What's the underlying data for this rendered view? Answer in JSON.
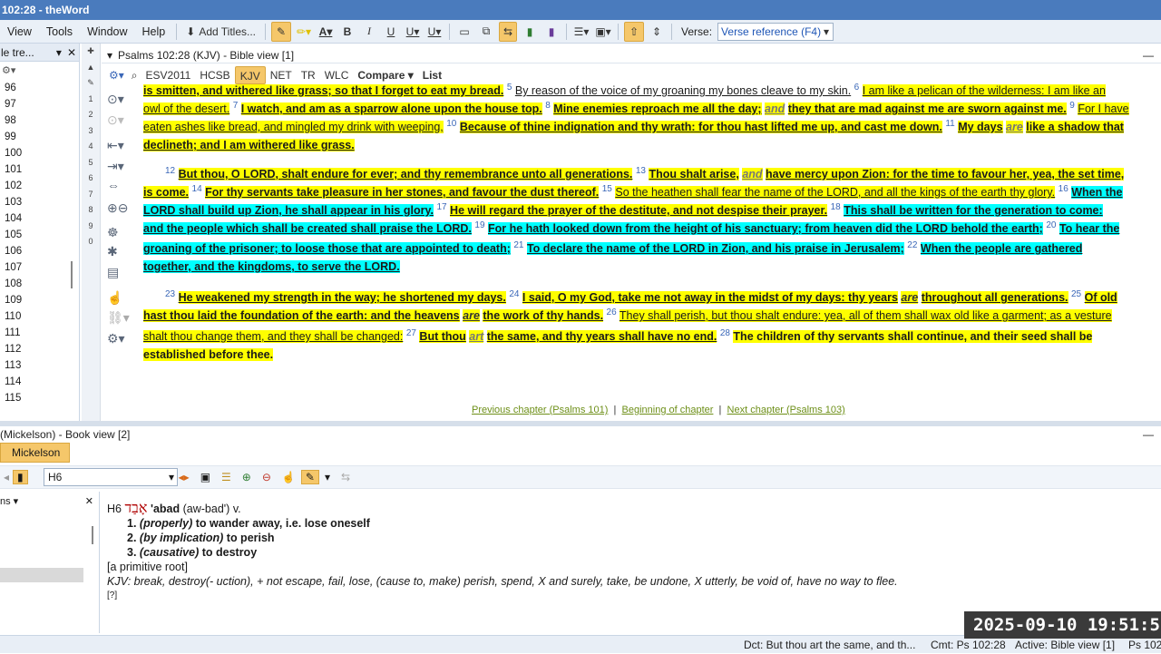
{
  "window": {
    "title": "102:28 - theWord"
  },
  "menu": [
    "View",
    "Tools",
    "Window",
    "Help"
  ],
  "toolbar": {
    "add_titles": "Add Titles...",
    "bold": "B",
    "italic": "I",
    "underline": "U",
    "verse_label": "Verse:",
    "verse_value": "Verse reference (F4)"
  },
  "tree": {
    "title": "le tre...",
    "numbers": [
      "96",
      "97",
      "98",
      "99",
      "100",
      "101",
      "102",
      "103",
      "104",
      "105",
      "106",
      "107",
      "108",
      "109",
      "110",
      "111",
      "112",
      "113",
      "114",
      "115"
    ]
  },
  "vtool_digits": [
    "1",
    "2",
    "3",
    "4",
    "5",
    "6",
    "7",
    "8",
    "9",
    "0"
  ],
  "bible": {
    "header": "Psalms 102:28 (KJV)  - Bible view [1]",
    "tabs": [
      "ESV2011",
      "HCSB",
      "KJV",
      "NET",
      "TR",
      "WLC"
    ],
    "active_tab": "KJV",
    "compare": "Compare",
    "list": "List",
    "nav": {
      "prev": "Previous chapter (Psalms 101)",
      "begin": "Beginning of chapter",
      "next": "Next chapter (Psalms 103)"
    },
    "t": {
      "l1a": "is smitten, and withered like grass; so that I forget to eat my bread.",
      "v5": "5",
      "l1b": "By reason of the voice of my groaning my bones cleave to my skin.",
      "v6": "6",
      "l1c": "I am like a pelican of the wilderness: I am like an",
      "l2a": "owl of the desert.",
      "v7": "7",
      "l2b": "I watch, and am as a sparrow alone upon the house top.",
      "v8": "8",
      "l2c": "Mine enemies reproach me all the day;",
      "l2d": "and",
      "l2e": "they that are mad against me are sworn against me.",
      "v9": "9",
      "l2f": "For I have",
      "l3a": "eaten ashes like bread, and mingled my drink with weeping,",
      "v10": "10",
      "l3b": "Because of thine indignation and thy wrath: for thou hast lifted me up, and cast me down.",
      "v11": "11",
      "l3c": "My days",
      "l3d": "are",
      "l3e": "like a shadow that",
      "l4a": "declineth; and I am withered like grass.",
      "v12": "12",
      "l5a": "But thou, O LORD, shalt endure for ever; and thy remembrance unto all generations.",
      "v13": "13",
      "l5b": "Thou shalt arise,",
      "l5c": "and",
      "l5d": "have mercy upon Zion: for the time to favour her, yea, the set time,",
      "l6a": "is come.",
      "v14": "14",
      "l6b": "For thy servants take pleasure in her stones, and favour the dust thereof.",
      "v15": "15",
      "l6c": "So the heathen shall fear the name of the LORD, and all the kings of the earth thy glory.",
      "v16": "16",
      "l6d": "When the",
      "l7a": "LORD shall build up Zion, he shall appear in his glory.",
      "v17": "17",
      "l7b": "He will regard the prayer of the destitute, and not despise their prayer.",
      "v18": "18",
      "l7c": "This shall be written for the generation to come:",
      "l8a": "and the people which shall be created shall praise the LORD.",
      "v19": "19",
      "l8b": "For he hath looked down from the height of his sanctuary; from heaven did the LORD behold the earth;",
      "v20": "20",
      "l8c": "To hear the",
      "l9a": "groaning of the prisoner; to loose those that are appointed to death;",
      "v21": "21",
      "l9b": "To declare the name of the LORD in Zion, and his praise in Jerusalem;",
      "v22": "22",
      "l9c": "When the people are gathered",
      "l10a": "together, and the kingdoms, to serve the LORD.",
      "v23": "23",
      "l11a": "He weakened my strength in the way; he shortened my days.",
      "v24": "24",
      "l11b": "I said, O my God, take me not away in the midst of my days: thy years",
      "l11c": "are",
      "l11d": "throughout all generations.",
      "v25": "25",
      "l11e": "Of old",
      "l12a": "hast thou laid the foundation of the earth: and the heavens",
      "l12b": "are",
      "l12c": "the work of thy hands.",
      "v26": "26",
      "l12d": "They shall perish, but thou shalt endure: yea, all of them shall wax old like a garment; as a vesture",
      "l13a": "shalt thou change them, and they shall be changed:",
      "v27": "27",
      "l13b": "But thou",
      "l13c": "art",
      "l13d": "the same, and thy years shall have no end.",
      "v28": "28",
      "l13e": "The children of thy servants shall continue, and their seed shall be",
      "l14a": "established before thee."
    }
  },
  "bookview": {
    "header": "(Mickelson) - Book view [2]",
    "tab": "Mickelson",
    "input": "H6",
    "left_title": "ns"
  },
  "entry": {
    "code": "H6",
    "hebrew": "אָבַד",
    "word": "'abad",
    "pron": "(aw-bad')",
    "pos": "v.",
    "defs": [
      {
        "n": "1.",
        "q": "(properly)",
        "d": "to wander away, i.e. lose oneself"
      },
      {
        "n": "2.",
        "q": "(by implication)",
        "d": "to perish"
      },
      {
        "n": "3.",
        "q": "(causative)",
        "d": "to destroy"
      }
    ],
    "root": "[a primitive root]",
    "kjv": "KJV: break, destroy(- uction), + not escape, fail, lose, (cause to, make) perish, spend, X and surely, take, be undone, X utterly, be void of, have no way to flee.",
    "qmark": "[?]"
  },
  "status": {
    "dct": "Dct:  But thou art the same, and th...",
    "cmt": "Cmt: Ps 102:28",
    "active": "Active: Bible view [1]",
    "ps": "Ps 102:"
  },
  "clock": "2025-09-10  19:51:5"
}
